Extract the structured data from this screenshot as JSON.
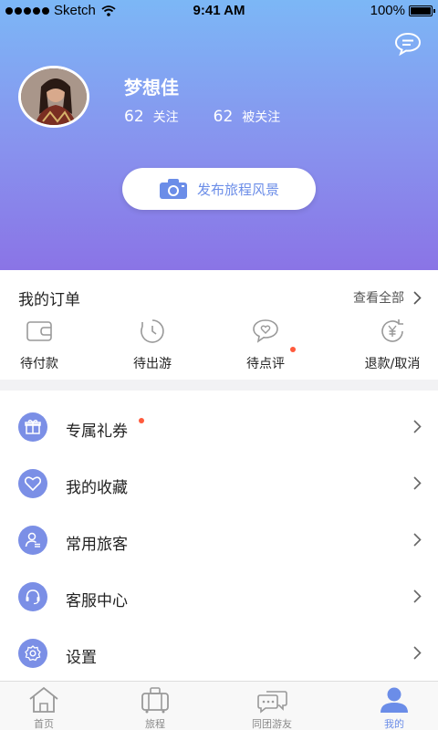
{
  "status_bar": {
    "carrier": "Sketch",
    "time": "9:41 AM",
    "battery": "100%"
  },
  "profile": {
    "name": "梦想佳",
    "following_count": "62",
    "following_label": "关注",
    "followers_count": "62",
    "followers_label": "被关注"
  },
  "publish_button": {
    "label": "发布旅程风景"
  },
  "orders": {
    "title": "我的订单",
    "view_all": "查看全部",
    "items": [
      {
        "label": "待付款",
        "icon": "wallet-icon"
      },
      {
        "label": "待出游",
        "icon": "clock-icon"
      },
      {
        "label": "待点评",
        "icon": "heart-chat-icon",
        "badge": true
      },
      {
        "label": "退款/取消",
        "icon": "refund-yen-icon"
      }
    ]
  },
  "menu": [
    {
      "label": "专属礼券",
      "icon": "gift-icon",
      "badge": true
    },
    {
      "label": "我的收藏",
      "icon": "heart-icon"
    },
    {
      "label": "常用旅客",
      "icon": "traveler-icon"
    },
    {
      "label": "客服中心",
      "icon": "headset-icon"
    },
    {
      "label": "设置",
      "icon": "settings-icon"
    }
  ],
  "tabs": [
    {
      "label": "首页",
      "icon": "home-icon"
    },
    {
      "label": "旅程",
      "icon": "luggage-icon"
    },
    {
      "label": "同团游友",
      "icon": "chat-icon"
    },
    {
      "label": "我的",
      "icon": "user-icon",
      "active": true
    }
  ],
  "colors": {
    "accent": "#6b8de8",
    "gradient_top": "#7cb7f6",
    "gradient_bottom": "#8a74e6",
    "badge": "#ff5a3c"
  }
}
